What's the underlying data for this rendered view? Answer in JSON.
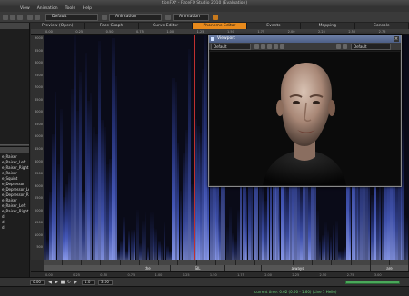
{
  "window": {
    "title": "tionFX* - FaceFX Studio 2010 (Evaluation)"
  },
  "menu": [
    "View",
    "Animation",
    "Tools",
    "Help"
  ],
  "toolbar": {
    "select1": "Default",
    "select2": "Animation",
    "select3": "Animation"
  },
  "left_panel": {
    "items": [
      "e_Raiser",
      "e_Raiser_Left",
      "e_Raiser_Right",
      "e_Raiser",
      "e_Squint",
      "e_Depressor",
      "e_Depressor_Left",
      "e_Depressor_Right",
      "e_Raiser",
      "e_Raiser_Left",
      "e_Raiser_Right",
      "d",
      "d",
      "d"
    ]
  },
  "tabs": [
    {
      "label": "Preview (Open)",
      "active": false
    },
    {
      "label": "Face Graph",
      "active": false
    },
    {
      "label": "Curve Editor",
      "active": false
    },
    {
      "label": "Phoneme Editor",
      "active": true
    },
    {
      "label": "Events",
      "active": false
    },
    {
      "label": "Mapping",
      "active": false
    },
    {
      "label": "Console",
      "active": false
    }
  ],
  "ruler_ticks": [
    "0.00",
    "0.25",
    "0.50",
    "0.75",
    "1.00",
    "1.25",
    "1.50",
    "1.75",
    "2.00",
    "2.25",
    "2.50",
    "2.75"
  ],
  "freq_ticks": [
    "9000",
    "8500",
    "8000",
    "7500",
    "7000",
    "6500",
    "6000",
    "5500",
    "5000",
    "4500",
    "4000",
    "3500",
    "3000",
    "2500",
    "2000",
    "1500",
    "1000",
    "500"
  ],
  "bottom_ticks": [
    "0.00",
    "0.25",
    "0.50",
    "0.75",
    "1.00",
    "1.25",
    "1.50",
    "1.75",
    "2.00",
    "2.25",
    "2.50",
    "2.75",
    "3.00"
  ],
  "words": [
    "",
    "the",
    "SIL",
    "",
    "always",
    "",
    "are"
  ],
  "phonemes": [
    "",
    "",
    "",
    "",
    "",
    "",
    "",
    "",
    "",
    "",
    "",
    "",
    "",
    "",
    "",
    "",
    "",
    "",
    ""
  ],
  "viewport": {
    "title": "Viewport",
    "camera_select": "Default",
    "view_select": "Default"
  },
  "transport": {
    "start": "0.00",
    "end": "3.00",
    "speed": "1.0"
  },
  "status": {
    "text": "current time: 0.62 (0.00 - 1.60) (Line 1 Hello)"
  },
  "colors": {
    "accent": "#e88a1c",
    "spectrogram_low": "#0a0b18",
    "spectrogram_high": "#8797e8",
    "status_green": "#6fd37e"
  }
}
